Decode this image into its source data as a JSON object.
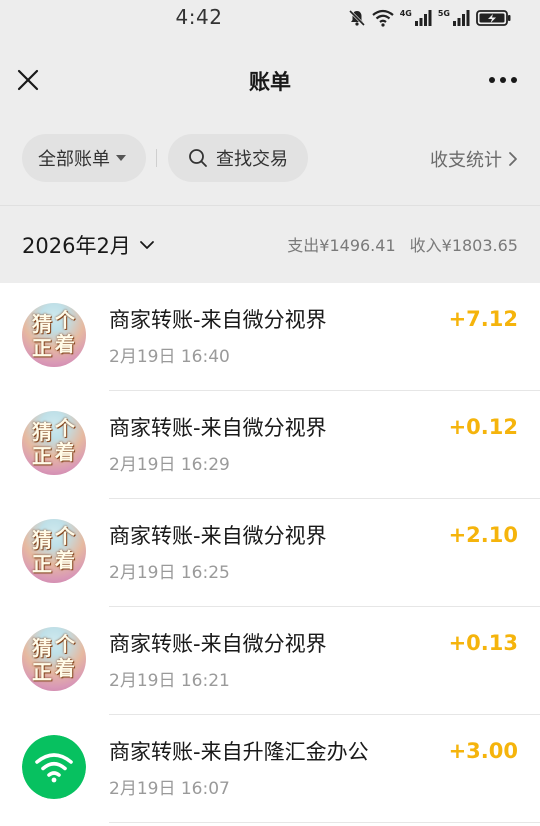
{
  "status_bar": {
    "time": "4:42",
    "net_1": "4G",
    "net_2": "5G"
  },
  "nav": {
    "title": "账单"
  },
  "filters": {
    "all_bills": "全部账单",
    "search": "查找交易",
    "stats": "收支统计"
  },
  "month": {
    "label": "2026年2月",
    "expense": "支出¥1496.41",
    "income": "收入¥1803.65"
  },
  "colors": {
    "amount": "#f5b40c",
    "wechat_green": "#07c160",
    "background": "#ededed"
  },
  "transactions": [
    {
      "title": "商家转账-来自微分视界",
      "time": "2月19日 16:40",
      "amount": "+7.12",
      "avatar": "photo-avatar",
      "avatar_text": [
        "猜",
        "个",
        "正",
        "着"
      ]
    },
    {
      "title": "商家转账-来自微分视界",
      "time": "2月19日 16:29",
      "amount": "+0.12",
      "avatar": "photo-avatar",
      "avatar_text": [
        "猜",
        "个",
        "正",
        "着"
      ]
    },
    {
      "title": "商家转账-来自微分视界",
      "time": "2月19日 16:25",
      "amount": "+2.10",
      "avatar": "photo-avatar",
      "avatar_text": [
        "猜",
        "个",
        "正",
        "着"
      ]
    },
    {
      "title": "商家转账-来自微分视界",
      "time": "2月19日 16:21",
      "amount": "+0.13",
      "avatar": "photo-avatar",
      "avatar_text": [
        "猜",
        "个",
        "正",
        "着"
      ]
    },
    {
      "title": "商家转账-来自升隆汇金办公",
      "time": "2月19日 16:07",
      "amount": "+3.00",
      "avatar": "wifi-icon"
    }
  ]
}
